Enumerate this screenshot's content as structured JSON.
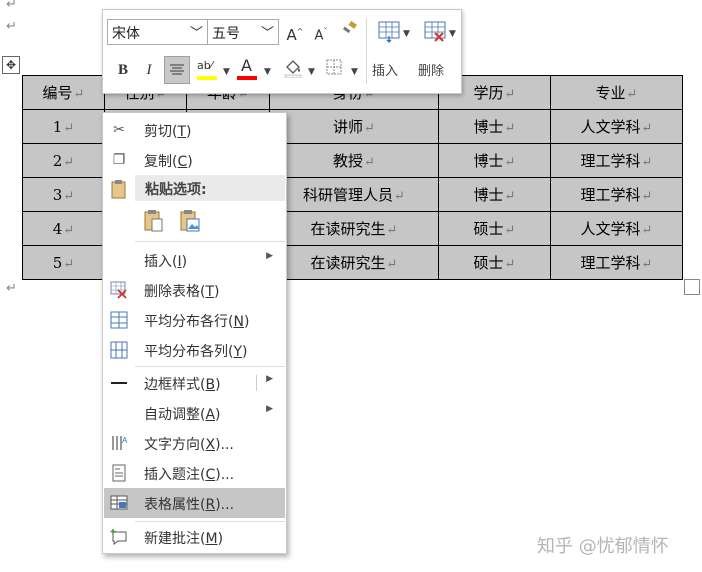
{
  "document": {
    "para_marks": [
      "↵",
      "↵",
      "↵"
    ],
    "table": {
      "headers": [
        "编号",
        "性别",
        "年龄",
        "身份",
        "学历",
        "专业"
      ],
      "rows": [
        [
          "1",
          "",
          "",
          "讲师",
          "博士",
          "人文学科"
        ],
        [
          "2",
          "",
          "",
          "教授",
          "博士",
          "理工学科"
        ],
        [
          "3",
          "",
          "",
          "科研管理人员",
          "博士",
          "理工学科"
        ],
        [
          "4",
          "",
          "",
          "在读研究生",
          "硕士",
          "人文学科"
        ],
        [
          "5",
          "",
          "",
          "在读研究生",
          "硕士",
          "理工学科"
        ]
      ],
      "cell_mark": "↵"
    }
  },
  "mini_toolbar": {
    "font_name": "宋体",
    "font_size": "五号",
    "grow_font": "A",
    "shrink_font": "A",
    "bold": "B",
    "italic": "I",
    "insert_label": "插入",
    "delete_label": "删除",
    "highlight_color": "#ffff00",
    "font_color": "#ff0000"
  },
  "context_menu": {
    "cut": {
      "label": "剪切(",
      "key": "T",
      "end": ")"
    },
    "copy": {
      "label": "复制(",
      "key": "C",
      "end": ")"
    },
    "paste_options_header": "粘贴选项:",
    "insert": {
      "label": "插入(",
      "key": "I",
      "end": ")"
    },
    "delete_table": {
      "label": "删除表格(",
      "key": "T",
      "end": ")"
    },
    "distribute_rows": {
      "label": "平均分布各行(",
      "key": "N",
      "end": ")"
    },
    "distribute_cols": {
      "label": "平均分布各列(",
      "key": "Y",
      "end": ")"
    },
    "border_styles": {
      "label": "边框样式(",
      "key": "B",
      "end": ")"
    },
    "autofit": {
      "label": "自动调整(",
      "key": "A",
      "end": ")"
    },
    "text_direction": {
      "label": "文字方向(",
      "key": "X",
      "end": ")..."
    },
    "insert_caption": {
      "label": "插入题注(",
      "key": "C",
      "end": ")..."
    },
    "table_properties": {
      "label": "表格属性(",
      "key": "R",
      "end": ")..."
    },
    "new_comment": {
      "label": "新建批注(",
      "key": "M",
      "end": ")"
    }
  },
  "watermark": "知乎 @忧郁情怀"
}
